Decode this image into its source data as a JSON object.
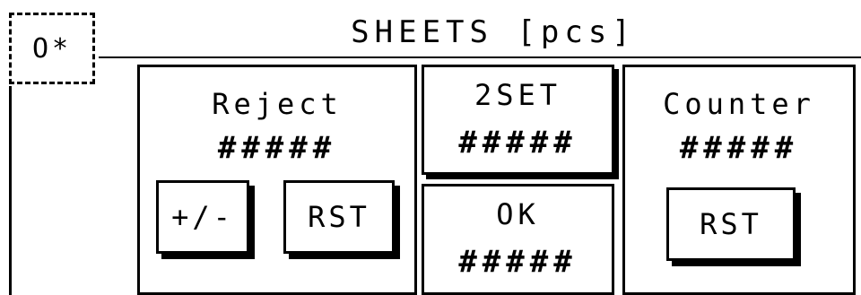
{
  "header": {
    "mode_indicator": "O*",
    "title": "SHEETS [pcs]"
  },
  "reject": {
    "label": "Reject",
    "value": "#####",
    "plus_minus_button": "+/-",
    "reset_button": "RST"
  },
  "set": {
    "label": "2SET",
    "value": "#####"
  },
  "ok": {
    "label": "OK",
    "value": "#####"
  },
  "counter": {
    "label": "Counter",
    "value": "#####",
    "reset_button": "RST"
  }
}
